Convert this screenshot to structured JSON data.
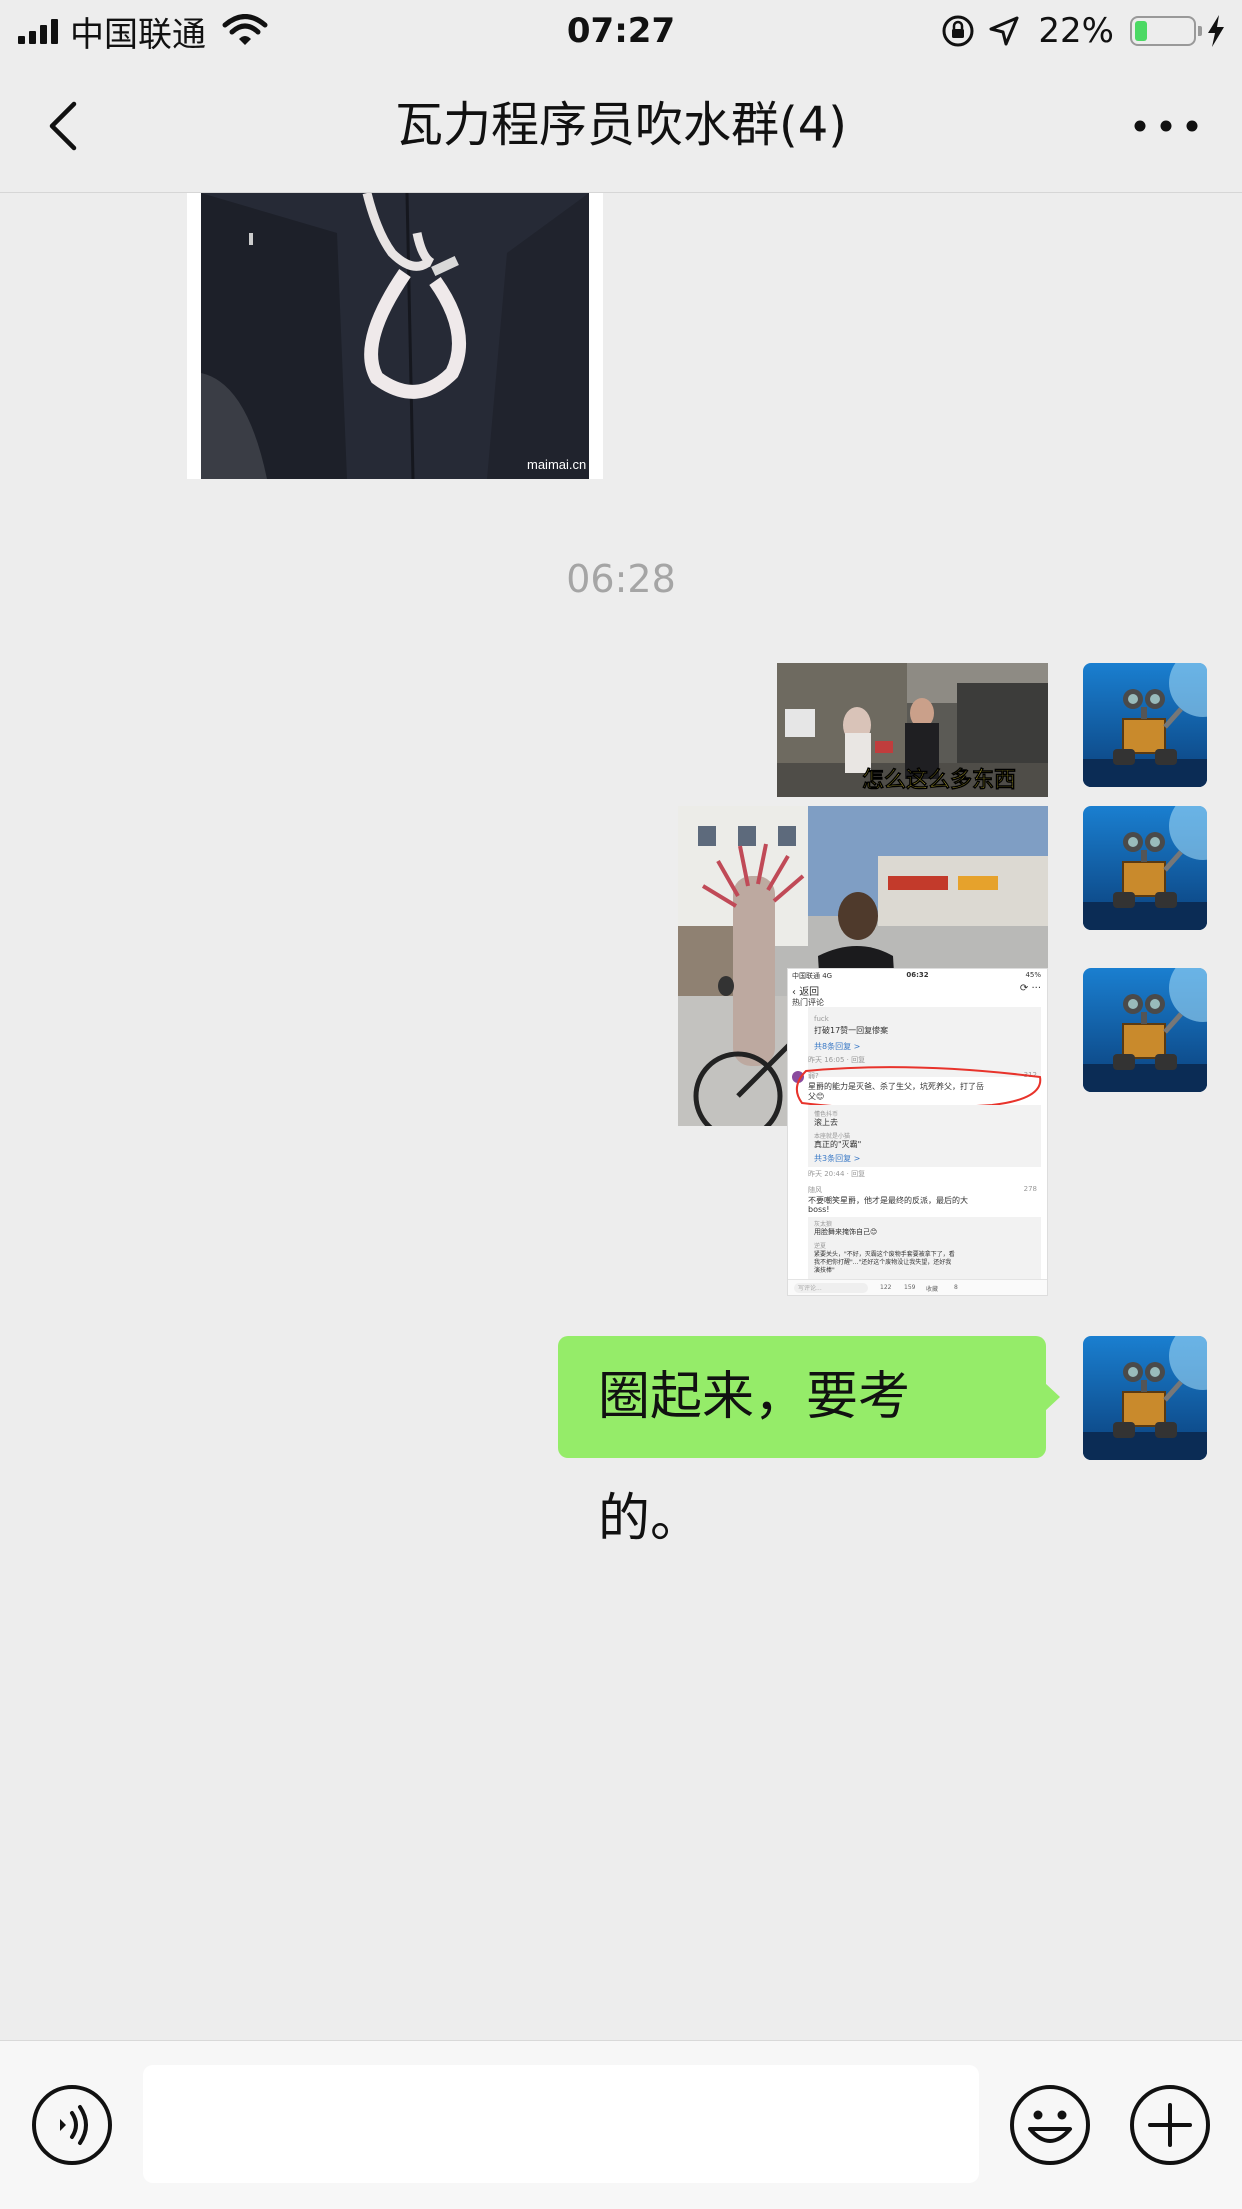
{
  "status_bar": {
    "carrier": "中国联通",
    "time": "07:27",
    "battery_percent": "22%",
    "battery_level": 0.22
  },
  "header": {
    "title": "瓦力程序员吹水群(4)"
  },
  "messages": {
    "image1_watermark": "maimai.cn",
    "timestamp": "06:28",
    "image2_caption": "怎么这么多东西",
    "text_message": "圈起来，要考的。"
  },
  "screenshot": {
    "carrier": "中国联通  4G",
    "time": "06:32",
    "battery": "45%",
    "back": "返回",
    "section": "热门评论",
    "c0_user": "fuck",
    "c0_text": "打破17赞一回复惨案",
    "c0_replies": "共8条回复 >",
    "c0_meta": "昨天 16:05 · 回复",
    "c1_user": "弱?",
    "c1_likes": "312",
    "c1_text1": "星爵的能力是灭爸、杀了生父，坑死养父，打了岳",
    "c1_text2": "父😊",
    "c1_r1_user": "懂色抖币",
    "c1_r1_text": "滚上去",
    "c1_r2_user": "本座就是小猫",
    "c1_r2_text": "真正的\"灭霸\"",
    "c1_replies": "共3条回复 >",
    "c1_meta": "昨天 20:44 · 回复",
    "c2_user": "随风",
    "c2_likes": "278",
    "c2_text1": "不要嘲笑星爵，他才是最终的反派，最后的大",
    "c2_text2": "boss!",
    "c2_r1_user": "灰太狼",
    "c2_r1_text": "用脸舞来掩饰自己😊",
    "c2_r2_user": "逆夏",
    "c2_r2_text1": "紧要关头，\"不好，灭霸这个废物手套要被拿下了，看",
    "c2_r2_text2": "我不把你打醒\"...\"还好这个废物没让我失望，还好我",
    "c2_r2_text3": "演技棒\"",
    "input_placeholder": "写评论...",
    "count_comments": "122",
    "count_likes": "159",
    "count_fav": "收藏",
    "count_share": "8"
  },
  "colors": {
    "background": "#ededed",
    "bubble_green": "#95ec69",
    "timestamp_grey": "#a5a5a5",
    "annotation_red": "#e8332b",
    "battery_green": "#4cd964"
  }
}
